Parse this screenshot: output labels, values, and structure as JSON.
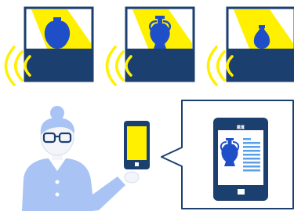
{
  "colors": {
    "navy": "#1b3f6e",
    "yellow": "#fff000",
    "vase_blue": "#1f4fc8",
    "person_blue": "#a9c4f4",
    "skin": "#f3f5fb",
    "white": "#ffffff",
    "light_blue": "#5aa0e8"
  },
  "panels": [
    {
      "name": "vase-panel-1",
      "object_icon": "round-vase-icon"
    },
    {
      "name": "vase-panel-2",
      "object_icon": "amphora-icon"
    },
    {
      "name": "vase-panel-3",
      "object_icon": "small-vase-icon"
    }
  ],
  "phone_screen": {
    "header_label": "鑑賞",
    "object_icon": "amphora-icon"
  }
}
